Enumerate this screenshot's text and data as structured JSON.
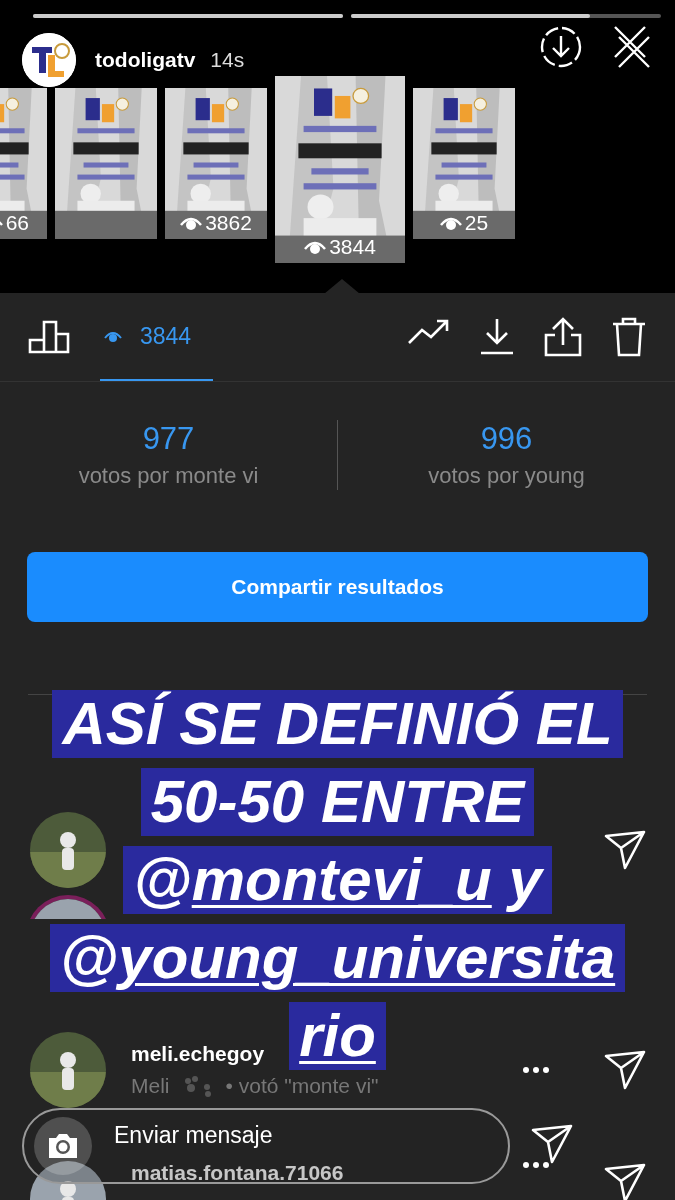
{
  "story": {
    "progress": [
      {
        "level": 1
      },
      {
        "level": 0.77
      }
    ],
    "username": "todoligatv",
    "time": "14s",
    "thumbnails": [
      {
        "views": "66",
        "selected": false
      },
      {
        "selected": false
      },
      {
        "views": "3862",
        "selected": false
      },
      {
        "views": "3844",
        "selected": true
      },
      {
        "views": "25",
        "selected": false
      }
    ]
  },
  "insights": {
    "tabs": [
      {
        "kind": "chart",
        "selected": false
      },
      {
        "kind": "views",
        "label": "3844",
        "selected": true
      }
    ],
    "poll_results": [
      {
        "count": "977",
        "label": "votos por monte vi"
      },
      {
        "count": "996",
        "label": "votos por young"
      }
    ],
    "share_button": "Compartir resultados"
  },
  "viewers": [
    {
      "story_ring": false,
      "menu": false,
      "send": true
    },
    {
      "story_ring": true,
      "menu": false,
      "send": false
    },
    {
      "story_ring": false,
      "menu": true,
      "send": true,
      "username": "meli.echegoy",
      "name": "Meli",
      "vote": "• votó \"monte vi\""
    },
    {
      "story_ring": false,
      "menu": true,
      "send": true,
      "username": "matias.fontana.71066"
    }
  ],
  "text_sticker": [
    [
      {
        "kind": "text",
        "text": "ASÍ SE DEFINIÓ EL"
      }
    ],
    [
      {
        "kind": "text",
        "text": "50-50 ENTRE"
      }
    ],
    [
      {
        "kind": "text",
        "text": "@"
      },
      {
        "kind": "mention",
        "text": "montevi_u"
      },
      {
        "kind": "text",
        "text": " y"
      }
    ],
    [
      {
        "kind": "text",
        "text": "@"
      },
      {
        "kind": "mention",
        "text": "young_universita"
      }
    ],
    [
      {
        "kind": "mention",
        "text": "rio"
      }
    ]
  ],
  "message_bar": {
    "placeholder": "Enviar mensaje"
  }
}
